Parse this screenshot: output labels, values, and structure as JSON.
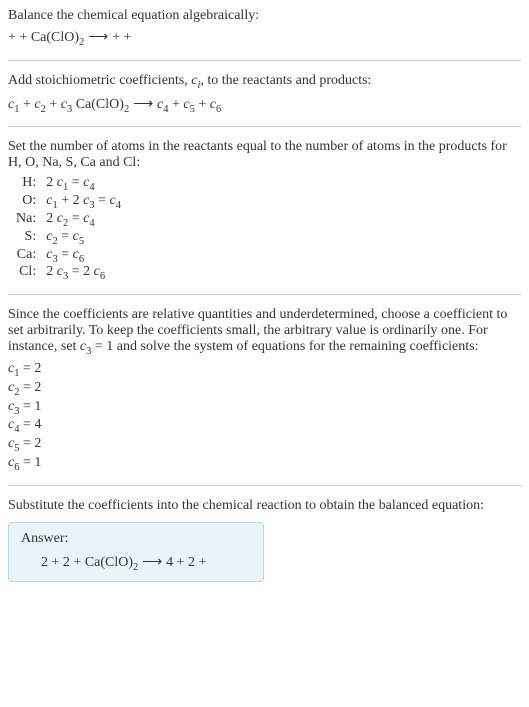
{
  "intro": {
    "line1": "Balance the chemical equation algebraically:",
    "reactant1_plus": " + ",
    "reactant2_plus": " + ",
    "compound": "Ca(ClO)",
    "compound_sub": "2",
    "arrow": " ⟶ ",
    "product1_plus": " + ",
    "product2_plus": " + "
  },
  "step1": {
    "line1_a": "Add stoichiometric coefficients, ",
    "line1_c": "c",
    "line1_i": "i",
    "line1_b": ", to the reactants and products:",
    "c1": "c",
    "s1": "1",
    "p1": " + ",
    "c2": "c",
    "s2": "2",
    "p2": " + ",
    "c3": "c",
    "s3": "3",
    "compound": " Ca(ClO)",
    "compound_sub": "2",
    "arrow": " ⟶ ",
    "c4": "c",
    "s4": "4",
    "p4": " + ",
    "c5": "c",
    "s5": "5",
    "p5": " + ",
    "c6": "c",
    "s6": "6"
  },
  "step2": {
    "line1": "Set the number of atoms in the reactants equal to the number of atoms in the products for H, O, Na, S, Ca and Cl:",
    "rows": [
      {
        "label": "H:",
        "eq_pre": "2 ",
        "c1": "c",
        "s1": "1",
        "mid": " = ",
        "c2": "c",
        "s2": "4"
      },
      {
        "label": "O:",
        "c1": "c",
        "s1": "1",
        "mid1": " + 2 ",
        "c2": "c",
        "s2": "3",
        "mid2": " = ",
        "c3": "c",
        "s3": "4"
      },
      {
        "label": "Na:",
        "eq_pre": "2 ",
        "c1": "c",
        "s1": "2",
        "mid": " = ",
        "c2": "c",
        "s2": "4"
      },
      {
        "label": "S:",
        "c1": "c",
        "s1": "2",
        "mid": " = ",
        "c2": "c",
        "s2": "5"
      },
      {
        "label": "Ca:",
        "c1": "c",
        "s1": "3",
        "mid": " = ",
        "c2": "c",
        "s2": "6"
      },
      {
        "label": "Cl:",
        "eq_pre": "2 ",
        "c1": "c",
        "s1": "3",
        "mid": " = 2 ",
        "c2": "c",
        "s2": "6"
      }
    ]
  },
  "step3": {
    "line1_a": "Since the coefficients are relative quantities and underdetermined, choose a coefficient to set arbitrarily. To keep the coefficients small, the arbitrary value is ordinarily one. For instance, set ",
    "c3": "c",
    "s3": "3",
    "eq1": " = 1",
    "line1_b": " and solve the system of equations for the remaining coefficients:",
    "coeffs": [
      {
        "c": "c",
        "s": "1",
        "v": " = 2"
      },
      {
        "c": "c",
        "s": "2",
        "v": " = 2"
      },
      {
        "c": "c",
        "s": "3",
        "v": " = 1"
      },
      {
        "c": "c",
        "s": "4",
        "v": " = 4"
      },
      {
        "c": "c",
        "s": "5",
        "v": " = 2"
      },
      {
        "c": "c",
        "s": "6",
        "v": " = 1"
      }
    ]
  },
  "step4": {
    "line1": "Substitute the coefficients into the chemical reaction to obtain the balanced equation:"
  },
  "answer": {
    "label": "Answer:",
    "n1": "2 ",
    "p1": " + ",
    "n2": "2 ",
    "p2": " + ",
    "compound": "Ca(ClO)",
    "compound_sub": "2",
    "arrow": " ⟶ ",
    "n4": "4 ",
    "p4": " + ",
    "n5": "2 ",
    "p5": " + "
  }
}
